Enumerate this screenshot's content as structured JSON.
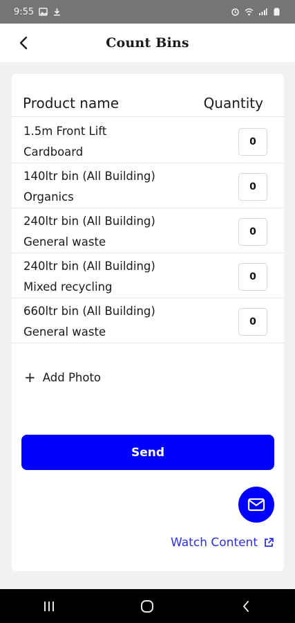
{
  "status_bar": {
    "time": "9:55"
  },
  "header": {
    "title": "Count Bins"
  },
  "table": {
    "columns": {
      "product": "Product name",
      "quantity": "Quantity"
    },
    "rows": [
      {
        "line1": "1.5m Front Lift",
        "line2": "Cardboard",
        "quantity": "0"
      },
      {
        "line1": "140ltr bin (All Building)",
        "line2": "Organics",
        "quantity": "0"
      },
      {
        "line1": "240ltr bin (All Building)",
        "line2": "General waste",
        "quantity": "0"
      },
      {
        "line1": "240ltr bin (All Building)",
        "line2": "Mixed recycling",
        "quantity": "0"
      },
      {
        "line1": "660ltr bin (All Building)",
        "line2": "General waste",
        "quantity": "0"
      }
    ]
  },
  "add_photo": {
    "label": "Add Photo",
    "icon": "plus-icon"
  },
  "send": {
    "label": "Send"
  },
  "watch": {
    "label": "Watch Content",
    "icon": "external-link-icon"
  },
  "colors": {
    "accent": "#0000ff",
    "link": "#2a2fe0"
  }
}
